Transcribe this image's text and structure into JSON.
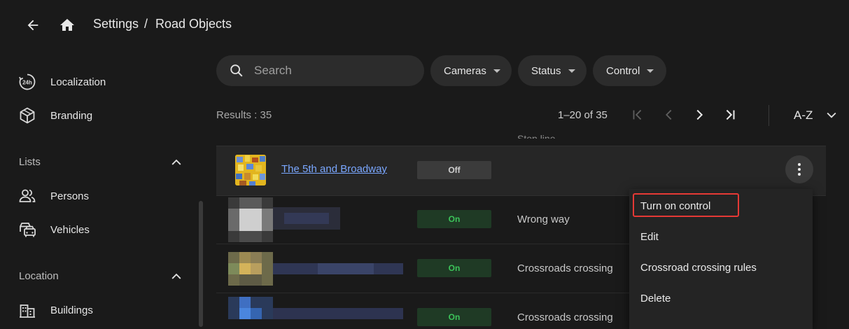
{
  "header": {
    "breadcrumb_root": "Settings",
    "breadcrumb_sep": "/",
    "breadcrumb_current": "Road Objects"
  },
  "sidebar": {
    "items_top": [
      {
        "label": "Localization",
        "icon": "clock-24h-icon"
      },
      {
        "label": "Branding",
        "icon": "cube-icon"
      }
    ],
    "sections": [
      {
        "label": "Lists",
        "items": [
          {
            "label": "Persons",
            "icon": "persons-icon"
          },
          {
            "label": "Vehicles",
            "icon": "vehicles-icon"
          }
        ]
      },
      {
        "label": "Location",
        "items": [
          {
            "label": "Buildings",
            "icon": "buildings-icon"
          }
        ]
      }
    ]
  },
  "search": {
    "placeholder": "Search",
    "value": ""
  },
  "filters": [
    {
      "label": "Cameras"
    },
    {
      "label": "Status"
    },
    {
      "label": "Control"
    }
  ],
  "results": {
    "label": "Results : 35",
    "range": "1–20 of 35",
    "sort": "A-Z"
  },
  "table": {
    "column_stop_line": "Stop line",
    "rows": [
      {
        "name": "The 5th and Broadway",
        "control": "Off",
        "violation": ""
      },
      {
        "name": "",
        "control": "On",
        "violation": "Wrong way"
      },
      {
        "name": "",
        "control": "On",
        "violation": "Crossroads crossing"
      },
      {
        "name": "",
        "control": "On",
        "violation": "Crossroads crossing"
      }
    ]
  },
  "menu": {
    "items": [
      {
        "label": "Turn on control"
      },
      {
        "label": "Edit"
      },
      {
        "label": "Crossroad crossing rules"
      },
      {
        "label": "Delete"
      }
    ]
  },
  "colors": {
    "background": "#1a1a1a",
    "link": "#7aa7ff",
    "on_text": "#3cc45a",
    "focus_outline": "#e53935"
  }
}
